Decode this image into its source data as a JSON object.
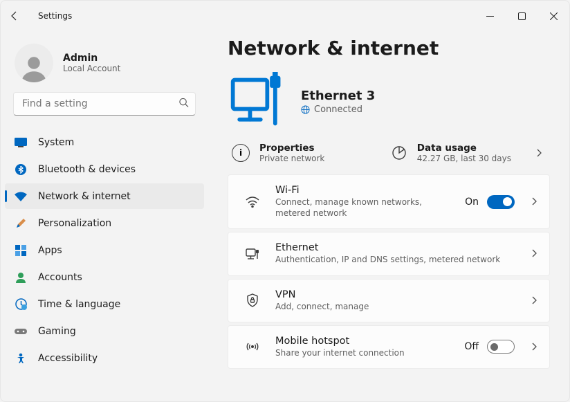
{
  "window": {
    "title": "Settings"
  },
  "user": {
    "name": "Admin",
    "sub": "Local Account"
  },
  "search": {
    "placeholder": "Find a setting"
  },
  "sidebar": {
    "items": [
      {
        "label": "System"
      },
      {
        "label": "Bluetooth & devices"
      },
      {
        "label": "Network & internet"
      },
      {
        "label": "Personalization"
      },
      {
        "label": "Apps"
      },
      {
        "label": "Accounts"
      },
      {
        "label": "Time & language"
      },
      {
        "label": "Gaming"
      },
      {
        "label": "Accessibility"
      }
    ],
    "selected_index": 2
  },
  "page": {
    "title": "Network & internet",
    "connection": {
      "name": "Ethernet 3",
      "status": "Connected"
    },
    "properties": {
      "title": "Properties",
      "sub": "Private network"
    },
    "data_usage": {
      "title": "Data usage",
      "sub": "42.27 GB, last 30 days"
    },
    "items": [
      {
        "icon": "wifi",
        "title": "Wi-Fi",
        "sub": "Connect, manage known networks, metered network",
        "toggle": {
          "state": "On",
          "on": true
        }
      },
      {
        "icon": "ethernet",
        "title": "Ethernet",
        "sub": "Authentication, IP and DNS settings, metered network"
      },
      {
        "icon": "vpn",
        "title": "VPN",
        "sub": "Add, connect, manage"
      },
      {
        "icon": "hotspot",
        "title": "Mobile hotspot",
        "sub": "Share your internet connection",
        "toggle": {
          "state": "Off",
          "on": false
        }
      }
    ]
  },
  "colors": {
    "accent": "#0067c0"
  }
}
